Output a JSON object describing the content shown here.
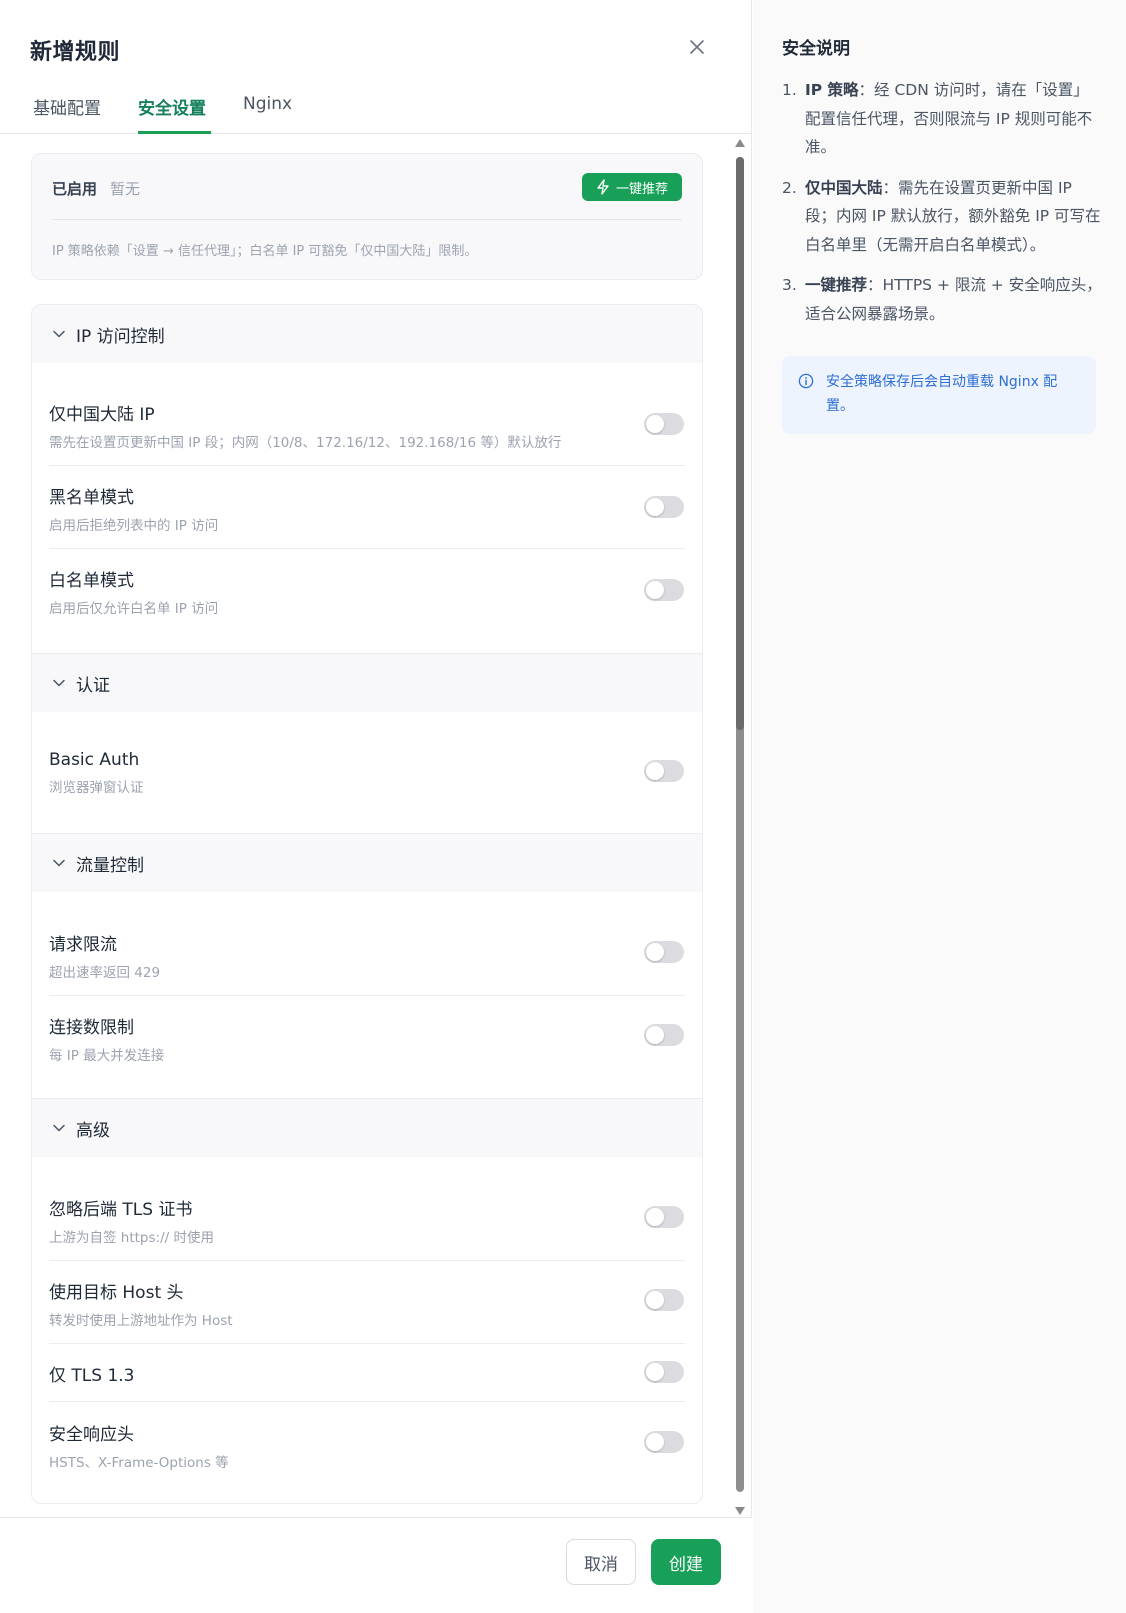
{
  "dialog": {
    "title": "新增规则",
    "tabs": [
      "基础配置",
      "安全设置",
      "Nginx"
    ],
    "active_tab": "安全设置"
  },
  "summary": {
    "label": "已启用",
    "value": "暂无",
    "recommend_button": "一键推荐",
    "note": "IP 策略依赖「设置 → 信任代理」；白名单 IP 可豁免「仅中国大陆」限制。"
  },
  "sections": [
    {
      "title": "IP 访问控制",
      "items": [
        {
          "title": "仅中国大陆 IP",
          "desc": "需先在设置页更新中国 IP 段；内网（10/8、172.16/12、192.168/16 等）默认放行",
          "enabled": false
        },
        {
          "title": "黑名单模式",
          "desc": "启用后拒绝列表中的 IP 访问",
          "enabled": false
        },
        {
          "title": "白名单模式",
          "desc": "启用后仅允许白名单 IP 访问",
          "enabled": false
        }
      ]
    },
    {
      "title": "认证",
      "items": [
        {
          "title": "Basic Auth",
          "desc": "浏览器弹窗认证",
          "enabled": false
        }
      ]
    },
    {
      "title": "流量控制",
      "items": [
        {
          "title": "请求限流",
          "desc": "超出速率返回 429",
          "enabled": false
        },
        {
          "title": "连接数限制",
          "desc": "每 IP 最大并发连接",
          "enabled": false
        }
      ]
    },
    {
      "title": "高级",
      "items": [
        {
          "title": "忽略后端 TLS 证书",
          "desc": "上游为自签 https:// 时使用",
          "enabled": false
        },
        {
          "title": "使用目标 Host 头",
          "desc": "转发时使用上游地址作为 Host",
          "enabled": false
        },
        {
          "title": "仅 TLS 1.3",
          "desc": "",
          "enabled": false
        },
        {
          "title": "安全响应头",
          "desc": "HSTS、X-Frame-Options 等",
          "enabled": false
        }
      ]
    }
  ],
  "footer": {
    "cancel": "取消",
    "create": "创建"
  },
  "help": {
    "title": "安全说明",
    "items": [
      {
        "num": "1.",
        "term": "IP 策略",
        "text": "：经 CDN 访问时，请在「设置」配置信任代理，否则限流与 IP 规则可能不准。"
      },
      {
        "num": "2.",
        "term": "仅中国大陆",
        "text": "：需先在设置页更新中国 IP 段；内网 IP 默认放行，额外豁免 IP 可写在白名单里（无需开启白名单模式）。"
      },
      {
        "num": "3.",
        "term": "一键推荐",
        "text": "：HTTPS + 限流 + 安全响应头，适合公网暴露场景。"
      }
    ],
    "info": "安全策略保存后会自动重载 Nginx 配置。"
  },
  "colors": {
    "accent": "#18a058",
    "info_text": "#2f6fd4",
    "info_bg": "#eef4fe",
    "toggle_off": "#dcdce0"
  }
}
